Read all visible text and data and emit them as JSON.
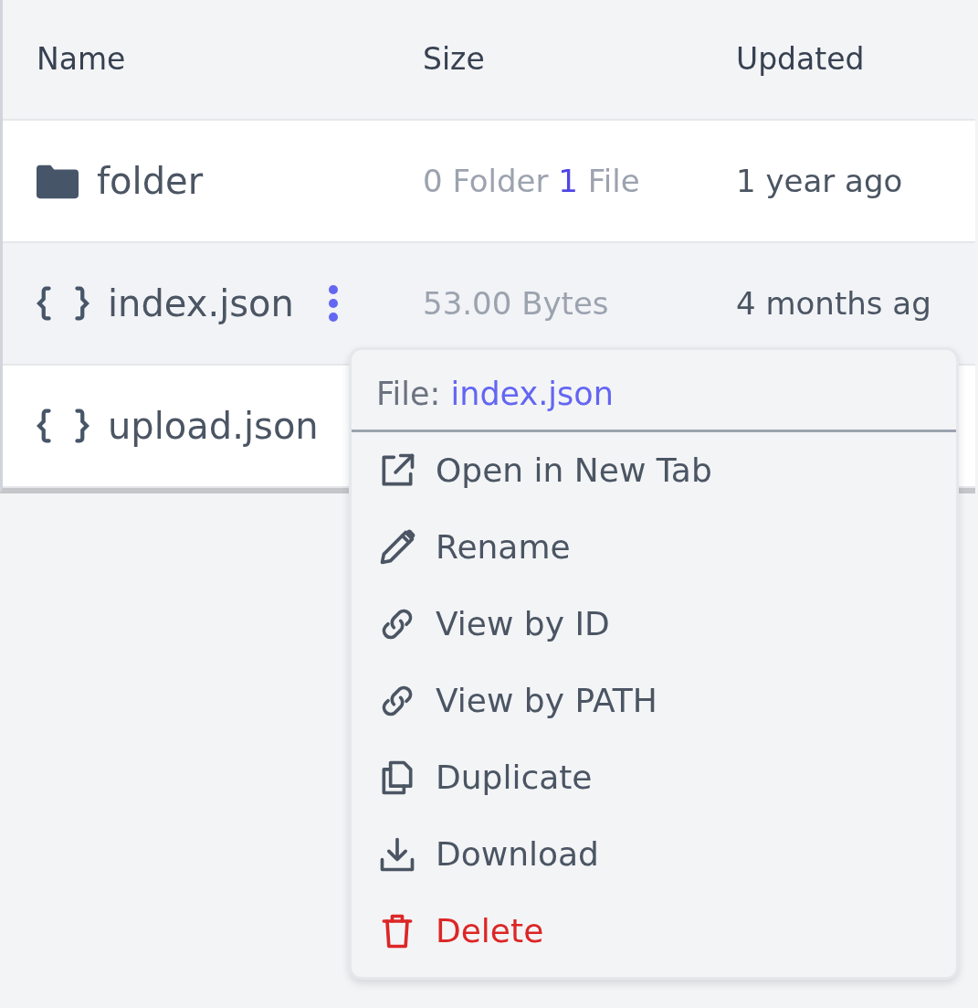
{
  "table": {
    "columns": [
      "Name",
      "Size",
      "Updated"
    ],
    "rows": [
      {
        "kind": "folder",
        "name": "folder",
        "menu_button": false,
        "hovered": false,
        "size": [
          {
            "text": "0 Folder",
            "highlight": false
          },
          {
            "text": "1",
            "highlight": true
          },
          {
            "text": "File",
            "highlight": false
          }
        ],
        "updated": "1 year ago"
      },
      {
        "kind": "json",
        "name": "index.json",
        "menu_button": true,
        "hovered": true,
        "size": [
          {
            "text": "53.00 Bytes",
            "highlight": false
          }
        ],
        "updated": "4 months ag"
      },
      {
        "kind": "json",
        "name": "upload.json",
        "menu_button": false,
        "hovered": false,
        "size": []
      }
    ]
  },
  "context_menu": {
    "label": "File:",
    "file": "index.json",
    "items": [
      {
        "kind": "open",
        "label": "Open in New Tab",
        "danger": false
      },
      {
        "kind": "rename",
        "label": "Rename",
        "danger": false
      },
      {
        "kind": "link",
        "label": "View by ID",
        "danger": false
      },
      {
        "kind": "link",
        "label": "View by PATH",
        "danger": false
      },
      {
        "kind": "duplicate",
        "label": "Duplicate",
        "danger": false
      },
      {
        "kind": "download",
        "label": "Download",
        "danger": false
      },
      {
        "kind": "delete",
        "label": "Delete",
        "danger": true
      }
    ]
  }
}
